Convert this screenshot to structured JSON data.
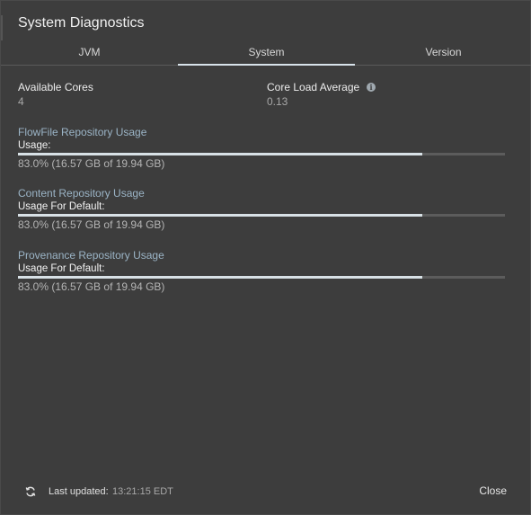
{
  "dialog": {
    "title": "System Diagnostics"
  },
  "tabs": [
    {
      "label": "JVM",
      "active": false
    },
    {
      "label": "System",
      "active": true
    },
    {
      "label": "Version",
      "active": false
    }
  ],
  "stats": {
    "available_cores_label": "Available Cores",
    "available_cores_value": "4",
    "core_load_label": "Core Load Average",
    "core_load_value": "0.13",
    "info_icon": "info-icon"
  },
  "repositories": [
    {
      "title": "FlowFile Repository Usage",
      "sublabel": "Usage:",
      "usage_text": "83.0% (16.57 GB of 19.94 GB)",
      "usage_fraction": 0.83
    },
    {
      "title": "Content Repository Usage",
      "sublabel": "Usage For Default:",
      "usage_text": "83.0% (16.57 GB of 19.94 GB)",
      "usage_fraction": 0.83
    },
    {
      "title": "Provenance Repository Usage",
      "sublabel": "Usage For Default:",
      "usage_text": "83.0% (16.57 GB of 19.94 GB)",
      "usage_fraction": 0.83
    }
  ],
  "footer": {
    "refresh_icon": "refresh-icon",
    "last_updated_label": "Last updated:",
    "last_updated_value": "13:21:15 EDT",
    "close_label": "Close"
  },
  "colors": {
    "background": "#3d3d3d",
    "repo_title": "#9bb4c6",
    "bar_fill": "#d8e1e6",
    "bar_track": "#5c5c5c"
  }
}
